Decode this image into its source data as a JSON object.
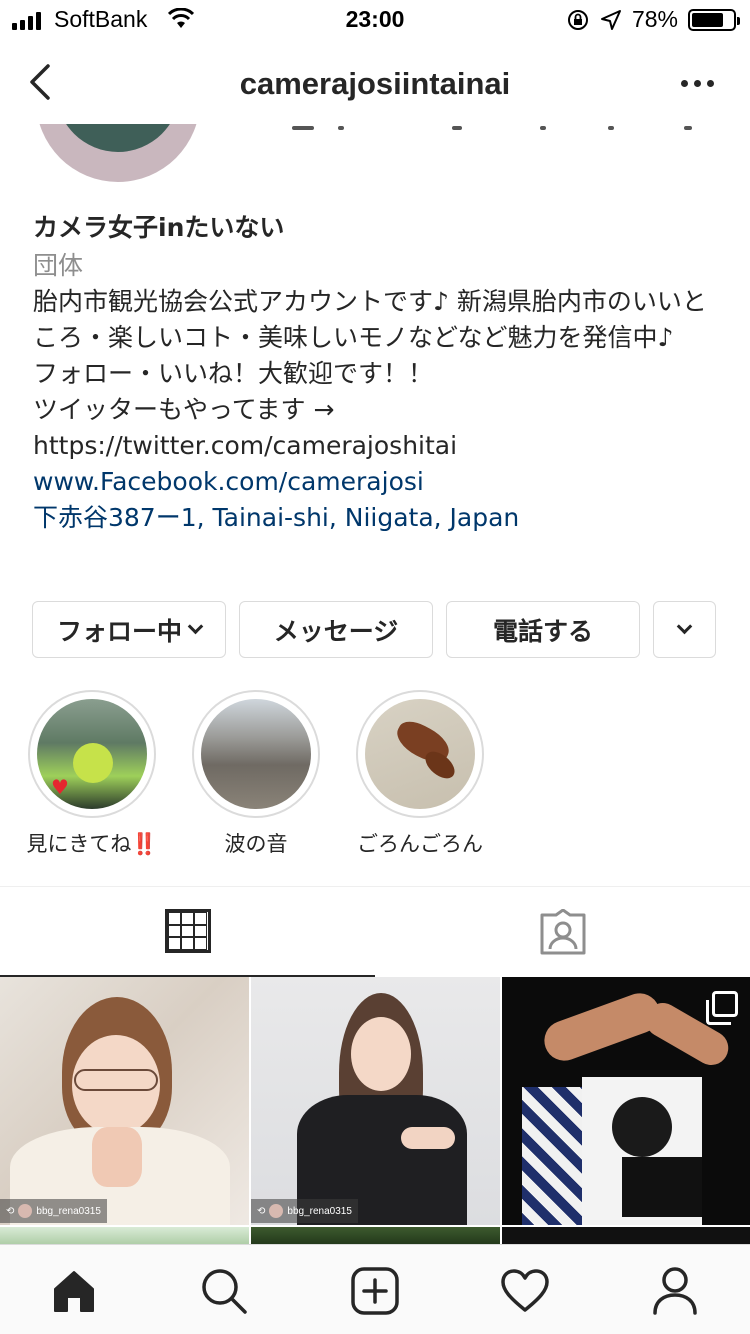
{
  "status": {
    "carrier": "SoftBank",
    "time": "23:00",
    "battery": "78%",
    "battery_level": 0.78
  },
  "header": {
    "title": "camerajosiintainai"
  },
  "profile": {
    "name": "カメラ女子inたいない",
    "category": "団体",
    "bio": "胎内市観光協会公式アカウントです♪ 新潟県胎内市のいいところ・楽しいコト・美味しいモノなどなど魅力を発信中♪\nフォロー・いいね！大歓迎です！！\nツイッターもやってます → https://twitter.com/camerajoshitai",
    "website": "www.Facebook.com/camerajosi",
    "address": "下赤谷387ー1, Tainai-shi, Niigata, Japan"
  },
  "buttons": {
    "following": "フォロー中",
    "message": "メッセージ",
    "call": "電話する"
  },
  "highlights": [
    {
      "label": "見にきてね‼️"
    },
    {
      "label": "波の音"
    },
    {
      "label": "ごろんごろん"
    }
  ],
  "posts": [
    {
      "credit": "bbg_rena0315"
    },
    {
      "credit": "bbg_rena0315"
    }
  ],
  "icons": [
    "back-icon",
    "more-icon",
    "grid-icon",
    "tagged-icon",
    "home-icon",
    "search-icon",
    "add-icon",
    "heart-icon",
    "profile-icon"
  ],
  "colors": {
    "link": "#00376b",
    "muted": "#8e8e8e",
    "border": "#dbdbdb"
  }
}
